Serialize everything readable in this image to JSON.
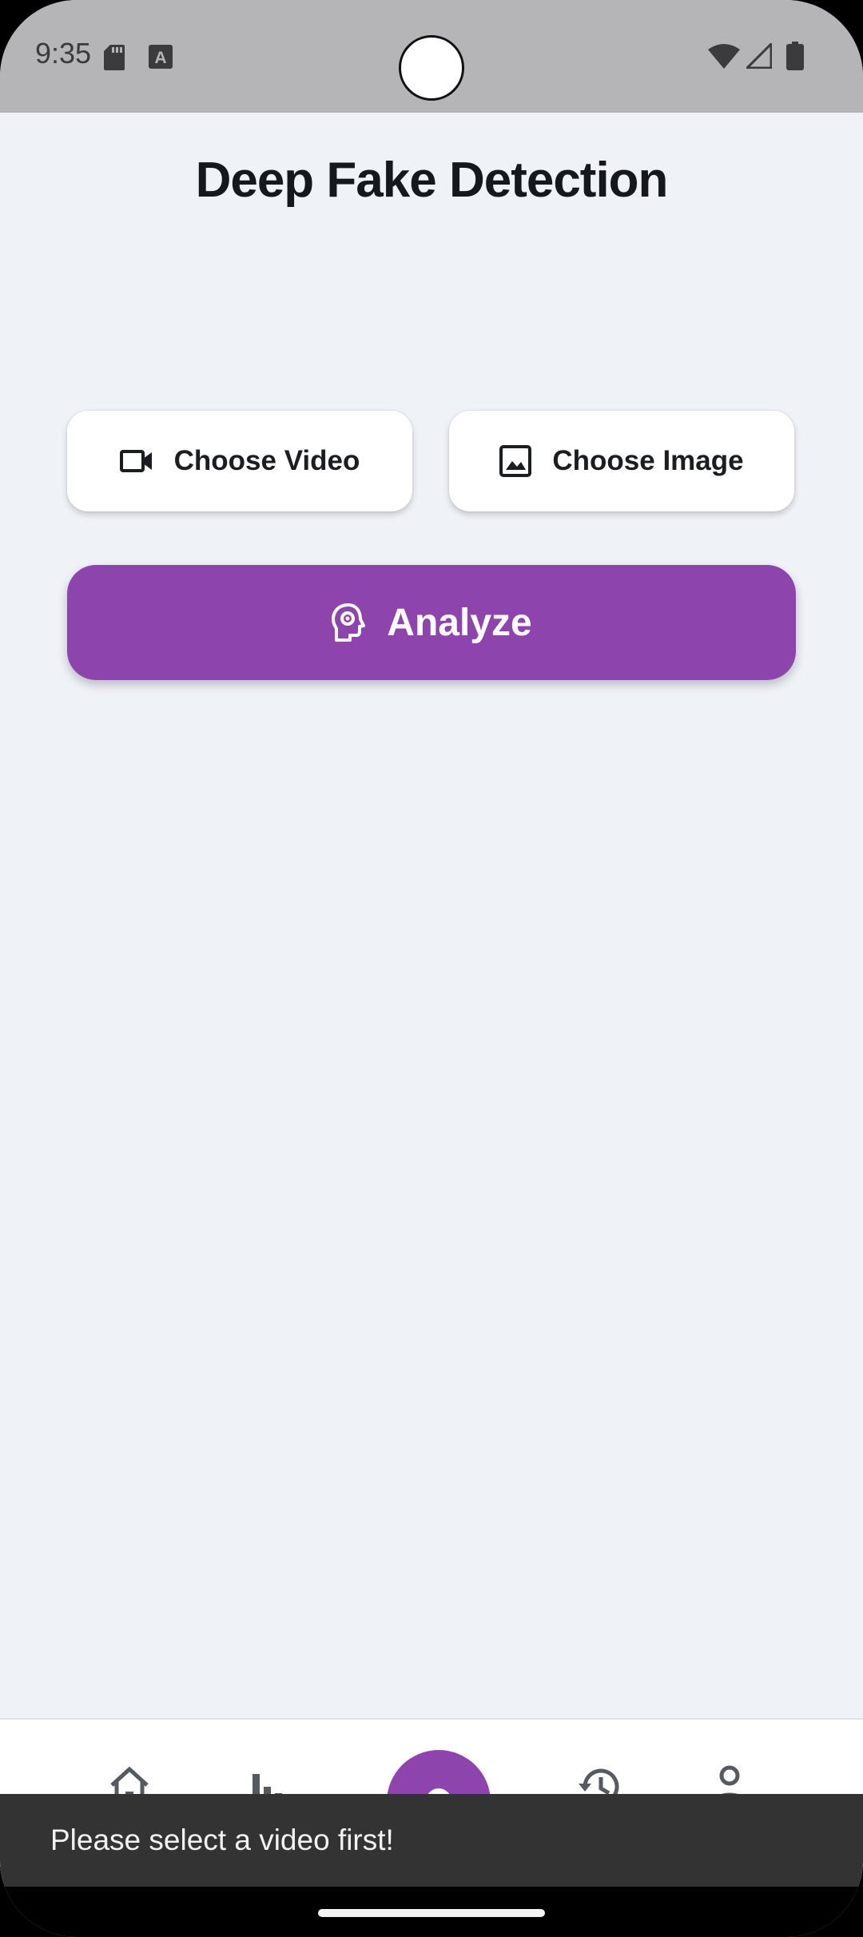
{
  "status_bar": {
    "time": "9:35",
    "icons": [
      "sd-card-icon",
      "keyboard-a-icon",
      "wifi-icon",
      "cell-signal-icon",
      "battery-icon"
    ]
  },
  "header": {
    "title": "Deep Fake Detection"
  },
  "actions": {
    "choose_video": {
      "label": "Choose Video",
      "icon": "videocam-icon"
    },
    "choose_image": {
      "label": "Choose Image",
      "icon": "image-icon"
    },
    "analyze": {
      "label": "Analyze",
      "icon": "psychology-head-icon"
    }
  },
  "bottom_nav": {
    "items": [
      {
        "icon": "home-icon"
      },
      {
        "icon": "bar-chart-icon"
      },
      {
        "icon": "center-action-icon"
      },
      {
        "icon": "history-icon"
      },
      {
        "icon": "person-icon"
      }
    ]
  },
  "snackbar": {
    "message": "Please select a video first!"
  },
  "colors": {
    "accent": "#8e44ad",
    "background": "#eff2f7",
    "status_bar": "#b5b5b8",
    "snackbar": "#333333"
  }
}
